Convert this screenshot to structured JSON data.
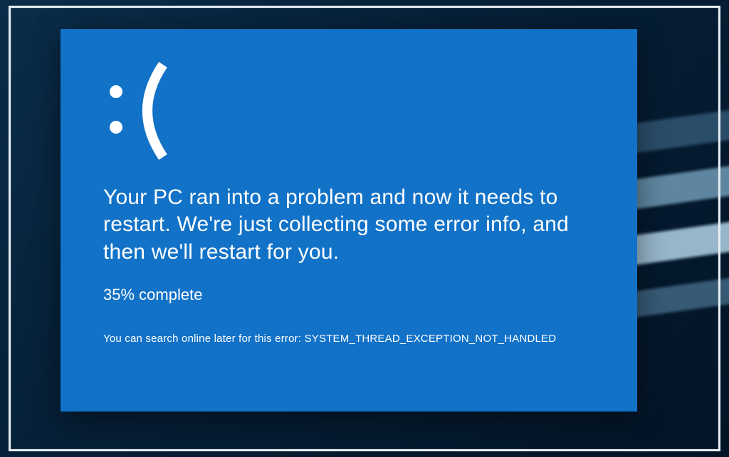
{
  "bsod": {
    "emoticon": ":(",
    "message": "Your PC ran into a problem and now it needs to restart. We're just collecting some error info, and then we'll restart for you.",
    "progress_percent": 35,
    "progress_suffix": "% complete",
    "search_prefix": "You can search online later for this error: ",
    "error_code": "SYSTEM_THREAD_EXCEPTION_NOT_HANDLED"
  },
  "colors": {
    "bsod_bg": "#1272c7",
    "text": "#ffffff"
  }
}
